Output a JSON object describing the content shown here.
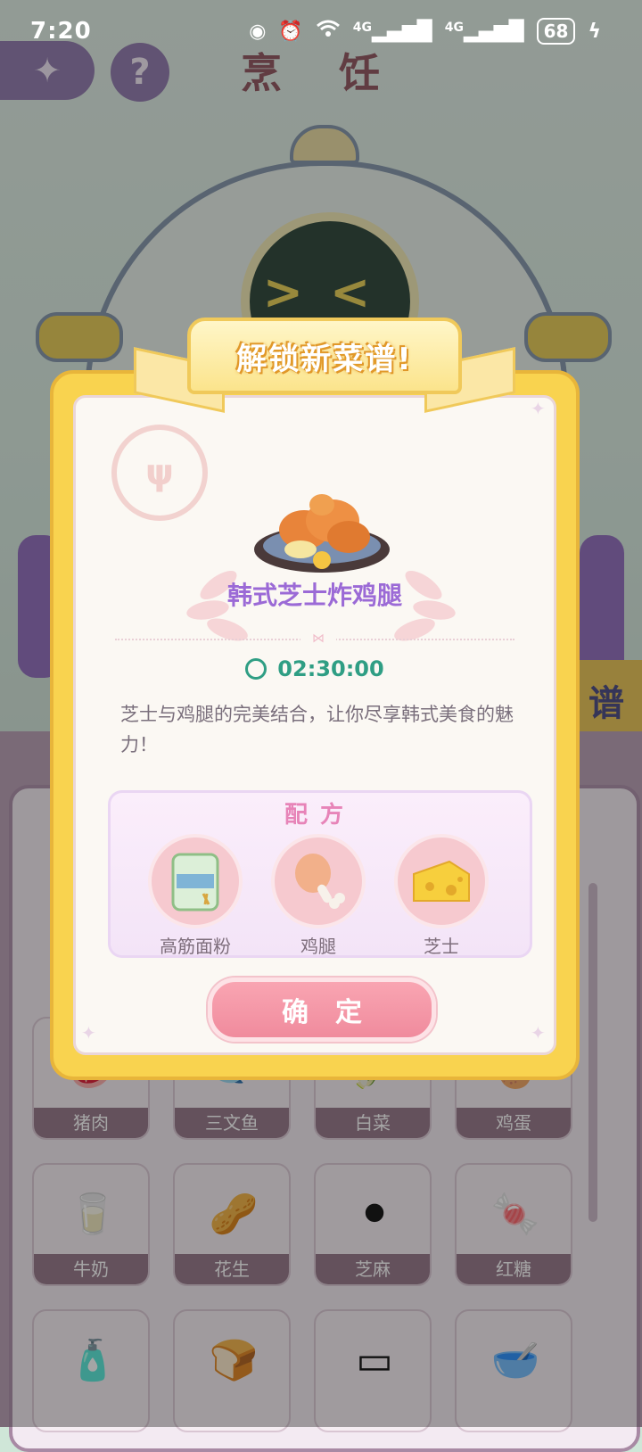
{
  "status_bar": {
    "time": "7:20",
    "signal_1": "4G",
    "signal_2": "4G",
    "battery": "68"
  },
  "scene": {
    "title": "烹 饪",
    "side_tab_label": "谱",
    "ingredient_grid": [
      {
        "label": "猪肉",
        "icon": "pork-icon"
      },
      {
        "label": "三文鱼",
        "icon": "salmon-icon"
      },
      {
        "label": "白菜",
        "icon": "cabbage-icon"
      },
      {
        "label": "鸡蛋",
        "icon": "egg-icon"
      },
      {
        "label": "牛奶",
        "icon": "milk-icon"
      },
      {
        "label": "花生",
        "icon": "peanut-icon"
      },
      {
        "label": "芝麻",
        "icon": "sesame-icon"
      },
      {
        "label": "红糖",
        "icon": "brown-sugar-icon"
      },
      {
        "label": "",
        "icon": "water-bottle-icon"
      },
      {
        "label": "",
        "icon": "bread-icon"
      },
      {
        "label": "",
        "icon": "tofu-box-icon"
      },
      {
        "label": "",
        "icon": "dumpling-bowl-icon"
      }
    ]
  },
  "modal": {
    "ribbon_title": "解锁新菜谱!",
    "dish_name": "韩式芝士炸鸡腿",
    "cook_time": "02:30:00",
    "description": "芝士与鸡腿的完美结合，让你尽享韩式美食的魅力！",
    "recipe_title": "配方",
    "ingredients": [
      {
        "label": "高筋面粉",
        "icon": "flour-bag-icon"
      },
      {
        "label": "鸡腿",
        "icon": "chicken-leg-icon"
      },
      {
        "label": "芝士",
        "icon": "cheese-icon"
      }
    ],
    "confirm_label": "确定"
  },
  "colors": {
    "modal_frame": "#f9d34f",
    "dish_name": "#9b6ad6",
    "timer": "#2f9e84",
    "recipe_title": "#e784b8",
    "confirm_button": "#f08b9d"
  }
}
